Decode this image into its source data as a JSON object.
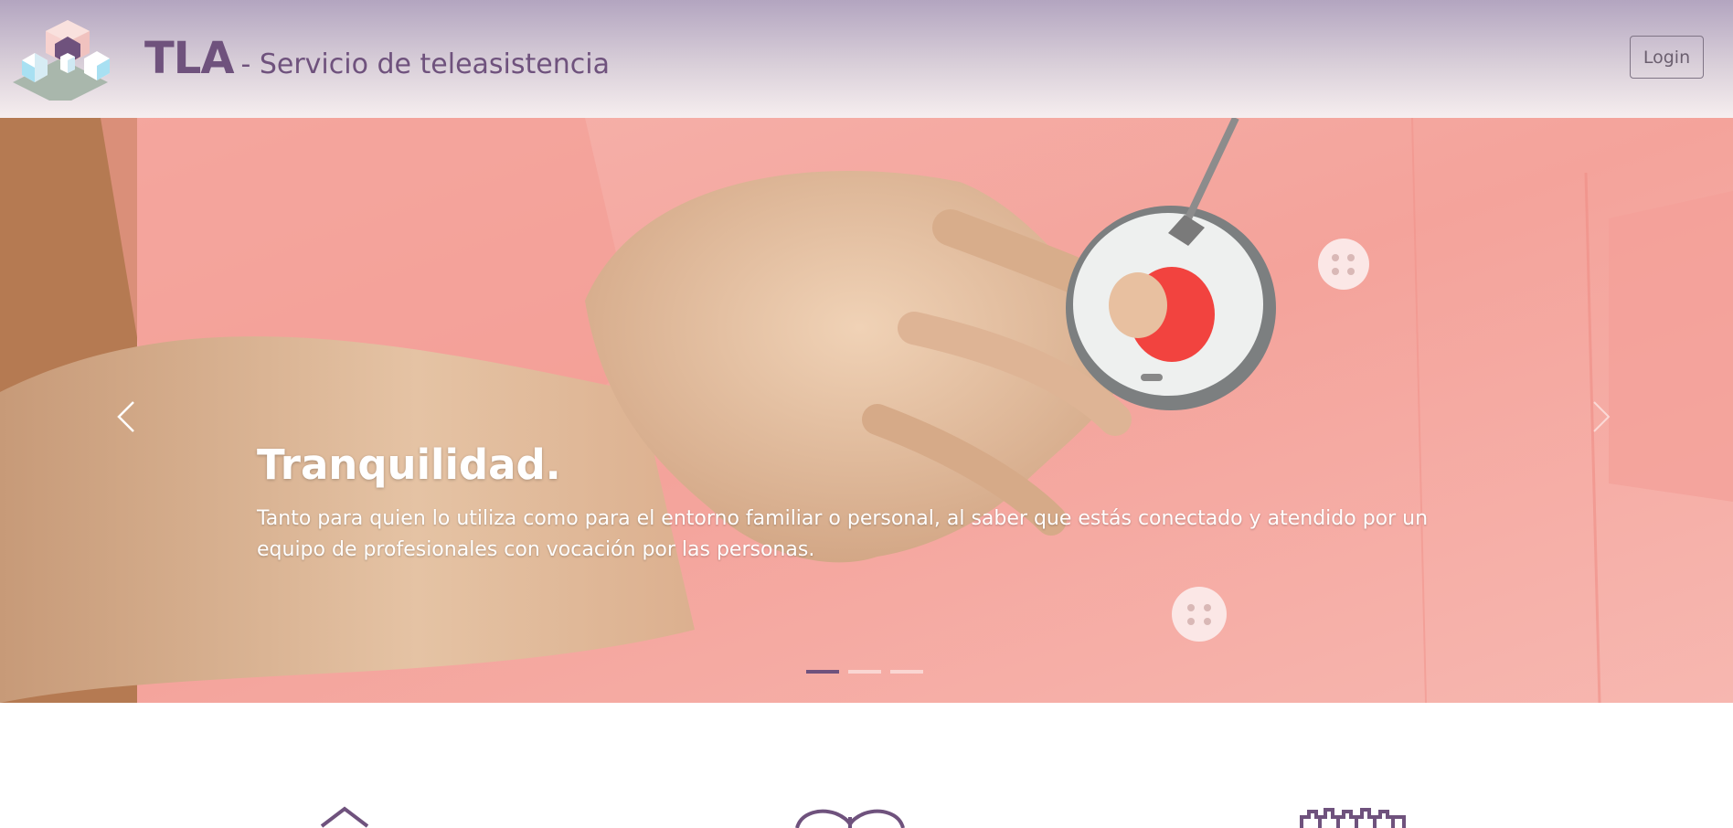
{
  "header": {
    "brand_name": "TLA",
    "brand_subtitle": "- Servicio de teleasistencia",
    "login_label": "Login"
  },
  "carousel": {
    "active_index": 0,
    "slide_count": 3,
    "caption_title": "Tranquilidad.",
    "caption_text": "Tanto para quien lo utiliza como para el entorno familiar o personal, al saber que estás conectado y atendido por un equipo de profesionales con vocación por las personas.",
    "prev_icon": "chevron-left-icon",
    "next_icon": "chevron-right-icon"
  },
  "features": {
    "icons": [
      "home-icon",
      "heart-icon",
      "building-icon"
    ]
  },
  "colors": {
    "brand": "#6f527d",
    "header_top": "#b3a5c0",
    "header_bottom": "#f6eeef",
    "indicator_active": "#6f527d"
  }
}
